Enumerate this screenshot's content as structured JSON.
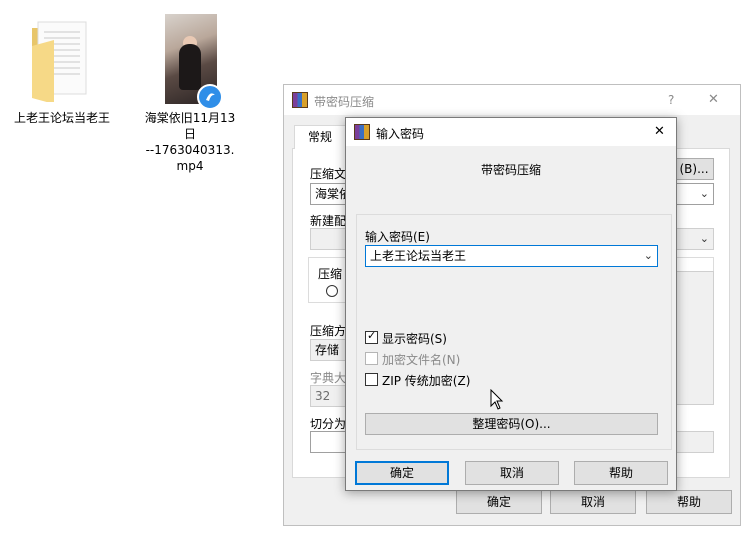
{
  "desktop": {
    "folder_label": "上老王论坛当老王",
    "video_label_lines": [
      "海棠依旧11月13",
      "日",
      "--1763040313.",
      "mp4"
    ]
  },
  "back_dialog": {
    "title": "带密码压缩",
    "help_glyph": "?",
    "close_glyph": "✕",
    "tab_general": "常规",
    "label_archive_name": "压缩文",
    "archive_name_value": "海棠依",
    "browse_button": "(B)...",
    "label_new_profile": "新建配",
    "label_archive_format": "压缩",
    "label_compress_method": "压缩方",
    "compress_method_value": "存储",
    "label_dict_size": "字典大",
    "dict_size_value": "32",
    "label_split": "切分为",
    "ok_button": "确定",
    "cancel_button": "取消",
    "help_button": "帮助"
  },
  "front_dialog": {
    "title": "输入密码",
    "close_glyph": "✕",
    "heading": "带密码压缩",
    "password_label": "输入密码(E)",
    "password_value": "上老王论坛当老王",
    "show_password_label": "显示密码(S)",
    "show_password_checked": true,
    "encrypt_filenames_label": "加密文件名(N)",
    "encrypt_filenames_checked": false,
    "zip_legacy_label": "ZIP 传统加密(Z)",
    "zip_legacy_checked": false,
    "organize_button": "整理密码(O)...",
    "ok_button": "确定",
    "cancel_button": "取消",
    "help_button": "帮助"
  }
}
